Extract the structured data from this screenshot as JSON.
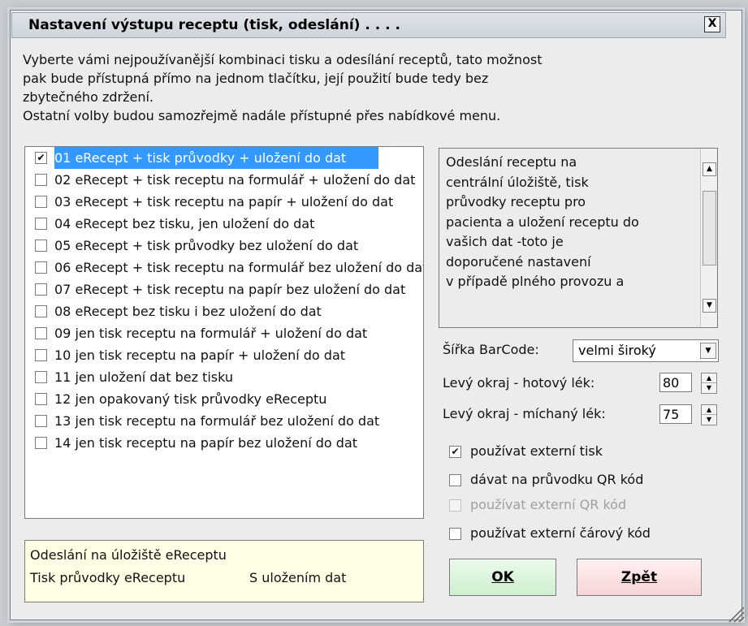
{
  "dialog": {
    "title": "Nastavení výstupu receptu (tisk, odeslání) . . . .",
    "close_label": "X"
  },
  "intro": {
    "line1": "Vyberte vámi nejpoužívanější kombinaci tisku a odesílání receptů, tato možnost",
    "line2": "pak bude přístupná přímo na jednom tlačítku, její použití bude tedy bez",
    "line3": "zbytečného zdržení.",
    "line4": "Ostatní volby budou samozřejmě nadále přístupné přes nabídkové menu."
  },
  "list": {
    "items": [
      {
        "label": "01  eRecept + tisk průvodky + uložení do dat",
        "checked": true
      },
      {
        "label": "02  eRecept + tisk receptu na formulář + uložení do dat",
        "checked": false
      },
      {
        "label": "03  eRecept + tisk receptu na papír + uložení do dat",
        "checked": false
      },
      {
        "label": "04  eRecept bez tisku, jen uložení do dat",
        "checked": false
      },
      {
        "label": "05  eRecept + tisk průvodky bez uložení do dat",
        "checked": false
      },
      {
        "label": "06  eRecept + tisk receptu na formulář bez uložení do dat",
        "checked": false
      },
      {
        "label": "07  eRecept + tisk receptu na papír bez uložení do dat",
        "checked": false
      },
      {
        "label": "08  eRecept bez tisku i bez uložení do dat",
        "checked": false
      },
      {
        "label": "09  jen tisk receptu na formulář + uložení do dat",
        "checked": false
      },
      {
        "label": "10  jen tisk receptu na papír + uložení do dat",
        "checked": false
      },
      {
        "label": "11  jen uložení dat bez tisku",
        "checked": false
      },
      {
        "label": "12  jen opakovaný tisk průvodky eReceptu",
        "checked": false
      },
      {
        "label": "13  jen tisk receptu na formulář bez uložení do dat",
        "checked": false
      },
      {
        "label": "14  jen tisk receptu na papír bez uložení do dat",
        "checked": false
      }
    ]
  },
  "summary": {
    "line1": "Odeslání na úložiště eReceptu",
    "line2a": "Tisk průvodky eReceptu",
    "line2b": "S uložením dat"
  },
  "description": {
    "lines": [
      "Odeslání receptu na",
      "centrální úložiště, tisk",
      "průvodky receptu pro",
      "pacienta a uložení receptu do",
      "vašich dat -toto je",
      "doporučené nastavení",
      "v případě plného provozu a"
    ]
  },
  "barcode": {
    "label": "Šířka BarCode:",
    "value": "velmi široký"
  },
  "margin_ready": {
    "label": "Levý okraj - hotový lék:",
    "value": "80"
  },
  "margin_mixed": {
    "label": "Levý okraj - míchaný lék:",
    "value": "75"
  },
  "options": {
    "external_print": {
      "label": "používat externí tisk",
      "checked": true
    },
    "qr_on_slip": {
      "label": "dávat na průvodku QR kód",
      "checked": false
    },
    "external_qr": {
      "label": "používat externí QR kód",
      "checked": false,
      "disabled": true
    },
    "external_barcode": {
      "label": "používat externí čárový kód",
      "checked": false
    }
  },
  "buttons": {
    "ok": "OK",
    "back": "Zpět"
  }
}
